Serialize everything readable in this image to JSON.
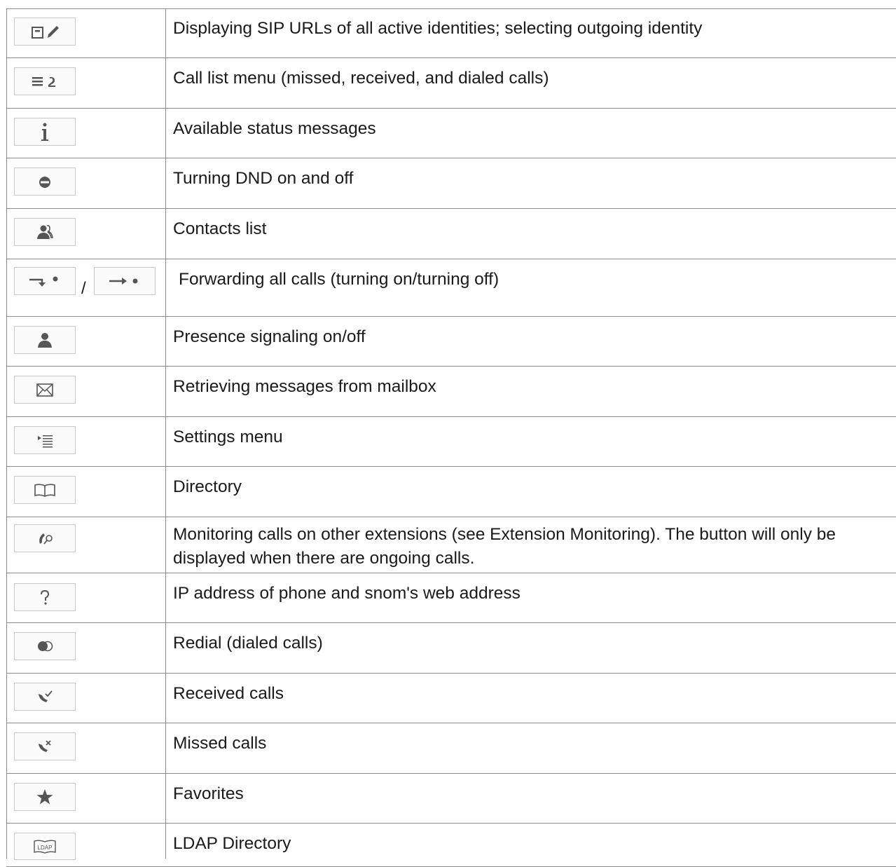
{
  "rows": [
    {
      "description": "Displaying SIP URLs of all active identities; selecting outgoing identity",
      "icon": "identity-edit-icon"
    },
    {
      "description": "Call list menu (missed, received, and dialed calls)",
      "icon": "call-list-icon"
    },
    {
      "description": "Available status messages",
      "icon": "info-icon"
    },
    {
      "description": "Turning DND on and off",
      "icon": "dnd-icon"
    },
    {
      "description": "Contacts list",
      "icon": "contacts-icon"
    },
    {
      "description": "Forwarding all calls (turning on/turning off)",
      "icon": "forward-on-icon",
      "icon_alt": "forward-off-icon",
      "separator": "/"
    },
    {
      "description": "Presence signaling on/off",
      "icon": "presence-icon"
    },
    {
      "description": "Retrieving messages from mailbox",
      "icon": "mailbox-icon"
    },
    {
      "description": "Settings menu",
      "icon": "settings-menu-icon"
    },
    {
      "description": "Directory",
      "icon": "directory-book-icon"
    },
    {
      "description": "Monitoring calls on other extensions (see Extension Monitoring).  The button will only be displayed when there are ongoing calls.",
      "icon": "monitoring-icon"
    },
    {
      "description": "IP address of phone and snom's web address",
      "icon": "help-icon"
    },
    {
      "description": "Redial (dialed calls)",
      "icon": "redial-icon"
    },
    {
      "description": "Received calls",
      "icon": "received-calls-icon"
    },
    {
      "description": "Missed calls",
      "icon": "missed-calls-icon"
    },
    {
      "description": "Favorites",
      "icon": "favorites-star-icon"
    },
    {
      "description": "LDAP Directory",
      "icon": "ldap-directory-icon",
      "icon_text": "LDAP"
    }
  ],
  "colors": {
    "border": "#8c8c8c",
    "button_border": "#c9c9c9",
    "icon": "#555555",
    "text": "#1a1a1a"
  }
}
